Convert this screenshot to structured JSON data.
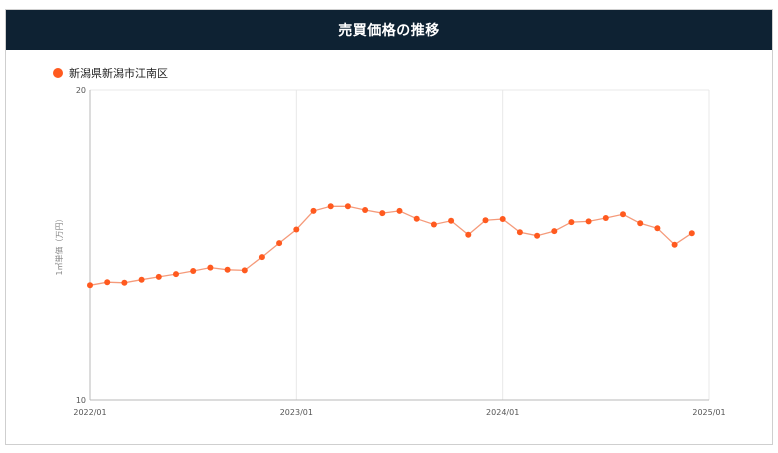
{
  "title": "売買価格の推移",
  "colors": {
    "header_bg": "#0e2233",
    "series": "#ff5a1f",
    "line": "#f59a7a"
  },
  "chart_data": {
    "type": "line",
    "title": "売買価格の推移",
    "ylabel": "1㎡単価（万円）",
    "xlabel": "",
    "ylim": [
      10,
      20
    ],
    "yticks": [
      "20",
      "10"
    ],
    "xticks": [
      {
        "label": "2022/01",
        "x": "2022-01"
      },
      {
        "label": "2023/01",
        "x": "2023-01"
      },
      {
        "label": "2024/01",
        "x": "2024-01"
      },
      {
        "label": "2025/01",
        "x": "2025-01"
      }
    ],
    "xrange": [
      "2022-01",
      "2025-01"
    ],
    "grid": true,
    "legend": "top-left",
    "series": [
      {
        "name": "新潟県新潟市江南区",
        "x": [
          "2022-01",
          "2022-02",
          "2022-03",
          "2022-04",
          "2022-05",
          "2022-06",
          "2022-07",
          "2022-08",
          "2022-09",
          "2022-10",
          "2022-11",
          "2022-12",
          "2023-01",
          "2023-02",
          "2023-03",
          "2023-04",
          "2023-05",
          "2023-06",
          "2023-07",
          "2023-08",
          "2023-09",
          "2023-10",
          "2023-11",
          "2023-12",
          "2024-01",
          "2024-02",
          "2024-03",
          "2024-04",
          "2024-05",
          "2024-06",
          "2024-07",
          "2024-08",
          "2024-09",
          "2024-10",
          "2024-11",
          "2024-12"
        ],
        "values": [
          13.7,
          13.8,
          13.78,
          13.88,
          13.97,
          14.06,
          14.16,
          14.27,
          14.2,
          14.18,
          14.61,
          15.06,
          15.5,
          16.1,
          16.25,
          16.25,
          16.13,
          16.03,
          16.1,
          15.85,
          15.66,
          15.78,
          15.33,
          15.8,
          15.84,
          15.41,
          15.3,
          15.45,
          15.74,
          15.76,
          15.87,
          15.99,
          15.7,
          15.54,
          15.01,
          15.38
        ]
      }
    ]
  }
}
